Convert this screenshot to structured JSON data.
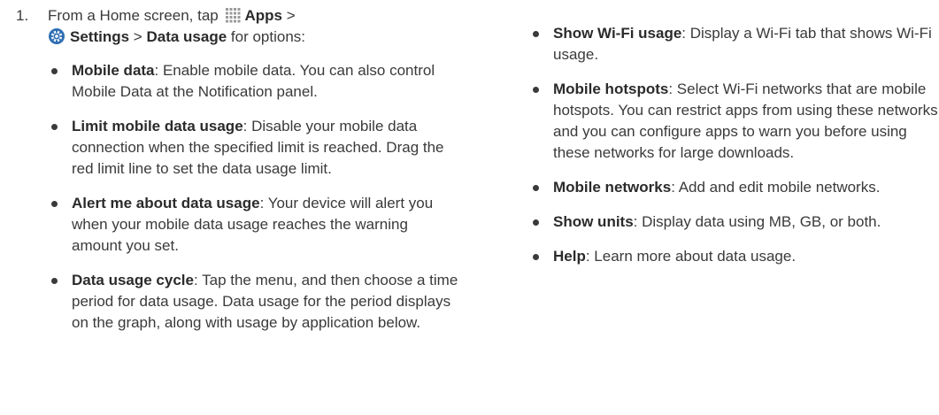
{
  "step": {
    "number": "1.",
    "line1_prefix": "From a Home screen, tap",
    "apps_label": "Apps",
    "separator1": ">",
    "settings_label": "Settings",
    "separator2": ">",
    "data_usage_label": "Data usage",
    "suffix": "for options:"
  },
  "left_items": [
    {
      "term": "Mobile data",
      "desc": ": Enable mobile data. You can also control Mobile Data at the Notification panel."
    },
    {
      "term": "Limit mobile data usage",
      "desc": ": Disable your mobile data connection when the specified limit is reached. Drag the red limit line to set the data usage limit."
    },
    {
      "term": "Alert me about data usage",
      "desc": ": Your device will alert you when your mobile data usage reaches the warning amount you set."
    },
    {
      "term": "Data usage cycle",
      "desc": ": Tap the menu, and then choose a time period for data usage. Data usage for the period displays on the graph, along with usage by application below."
    }
  ],
  "right_items": [
    {
      "term": "Show Wi-Fi usage",
      "desc": ": Display a Wi-Fi tab that shows Wi-Fi usage."
    },
    {
      "term": "Mobile hotspots",
      "desc": ": Select Wi-Fi networks that are mobile hotspots. You can restrict apps from using these networks, and you can configure apps to warn you before using these networks for large downloads."
    },
    {
      "term": "Mobile networks",
      "desc": ": Add and edit mobile networks."
    },
    {
      "term": "Show units",
      "desc": ": Display data using MB, GB, or both."
    },
    {
      "term": "Help",
      "desc": ": Learn more about data usage."
    }
  ],
  "icons": {
    "apps": "apps-grid-icon",
    "settings": "settings-gear-icon"
  },
  "colors": {
    "text": "#3a3a3a",
    "settings_icon": "#2f6fb3"
  }
}
